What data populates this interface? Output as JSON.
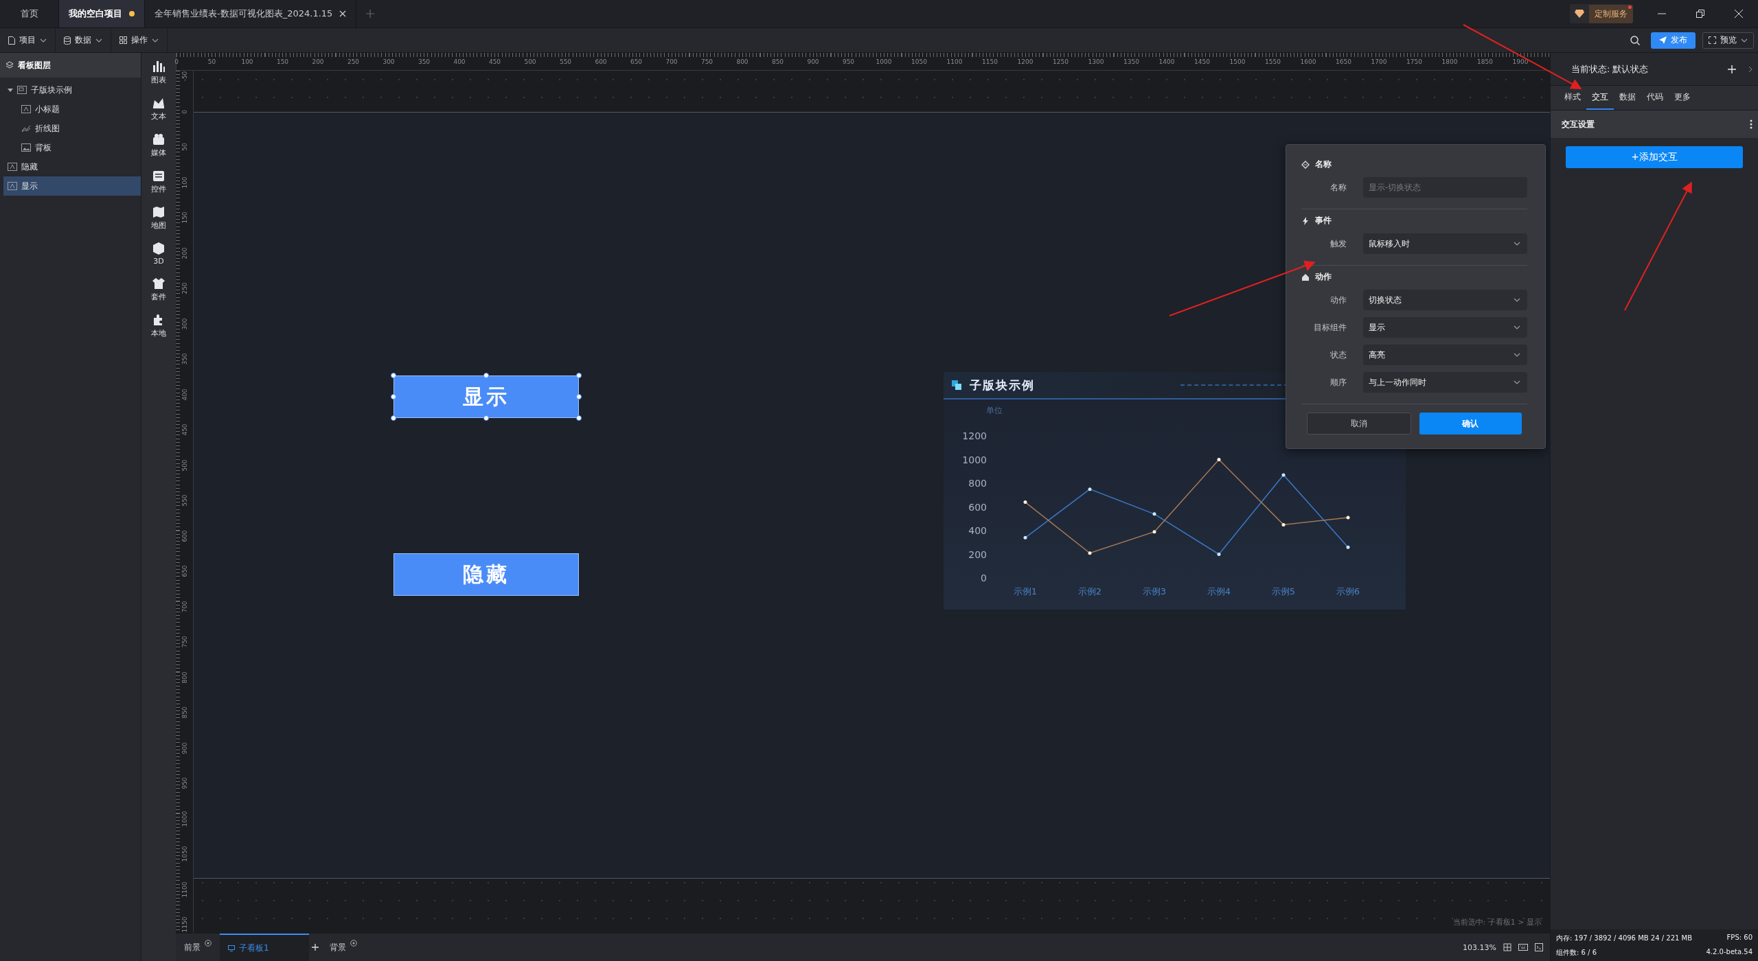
{
  "title_bar": {
    "tabs": [
      {
        "label": "首页",
        "selected": false,
        "modified": false,
        "closable": false
      },
      {
        "label": "我的空白项目",
        "selected": true,
        "modified": true,
        "closable": false
      },
      {
        "label": "全年销售业绩表-数据可视化图表_2024.1.15",
        "selected": false,
        "modified": false,
        "closable": true
      }
    ],
    "service_button": {
      "label": "定制服务",
      "badge": true
    }
  },
  "toolbar": {
    "menus": [
      "项目",
      "数据",
      "操作"
    ],
    "publish": "发布",
    "preview": "预览"
  },
  "layers": {
    "title": "看板图层",
    "items": [
      {
        "label": "子版块示例",
        "kind": "group",
        "expanded": true,
        "selected": false,
        "children": [
          {
            "label": "小标题",
            "kind": "text",
            "selected": false
          },
          {
            "label": "折线图",
            "kind": "chart",
            "selected": false
          },
          {
            "label": "背板",
            "kind": "image",
            "selected": false
          }
        ]
      },
      {
        "label": "隐藏",
        "kind": "text",
        "selected": false
      },
      {
        "label": "显示",
        "kind": "text",
        "selected": true
      }
    ]
  },
  "components": [
    "图表",
    "文本",
    "媒体",
    "控件",
    "地图",
    "3D",
    "套件",
    "本地"
  ],
  "ruler": {
    "x_ticks": [
      "0",
      "50",
      "100",
      "150",
      "200",
      "250",
      "300",
      "350",
      "400",
      "450",
      "500",
      "550",
      "600",
      "650",
      "700",
      "750",
      "800",
      "850",
      "900",
      "950",
      "1000",
      "1050",
      "1100",
      "1150",
      "1200",
      "1250",
      "1300",
      "1350",
      "1400",
      "1450",
      "1500",
      "1550",
      "1600",
      "1650",
      "1700",
      "1750",
      "1800",
      "1850",
      "1900"
    ],
    "y_ticks": [
      "-50",
      "0",
      "50",
      "100",
      "150",
      "200",
      "250",
      "300",
      "350",
      "400",
      "450",
      "500",
      "550",
      "600",
      "650",
      "700",
      "750",
      "800",
      "850",
      "900",
      "950",
      "1000",
      "1050",
      "1100",
      "1150"
    ]
  },
  "canvas": {
    "widgets": [
      {
        "kind": "button",
        "label": "显示",
        "selected": true
      },
      {
        "kind": "button",
        "label": "隐藏",
        "selected": false
      },
      {
        "kind": "chart_panel",
        "title": "子版块示例",
        "chart_data": {
          "type": "line",
          "ylabel": "单位",
          "categories": [
            "示例1",
            "示例2",
            "示例3",
            "示例4",
            "示例5",
            "示例6"
          ],
          "ylim": [
            0,
            1200
          ],
          "yticks": [
            0,
            200,
            400,
            600,
            800,
            1000,
            1200
          ],
          "series": [
            {
              "color": "#3a78c8",
              "values": [
                340,
                750,
                540,
                200,
                870,
                260
              ]
            },
            {
              "color": "#a97a55",
              "values": [
                640,
                210,
                390,
                1000,
                450,
                510
              ]
            }
          ]
        }
      }
    ],
    "selection_path": "当前选中:  子看板1 > 显示"
  },
  "popup": {
    "sections": [
      {
        "title": "名称",
        "kind": "name",
        "fields": [
          {
            "label": "名称",
            "kind": "input",
            "placeholder": "显示-切换状态"
          }
        ]
      },
      {
        "title": "事件",
        "kind": "event",
        "fields": [
          {
            "label": "触发",
            "kind": "select",
            "value": "鼠标移入时"
          }
        ]
      },
      {
        "title": "动作",
        "kind": "action",
        "fields": [
          {
            "label": "动作",
            "kind": "select",
            "value": "切换状态"
          },
          {
            "label": "目标组件",
            "kind": "select",
            "value": "显示"
          },
          {
            "label": "状态",
            "kind": "select",
            "value": "高亮"
          },
          {
            "label": "顺序",
            "kind": "select",
            "value": "与上一动作同时"
          }
        ]
      }
    ],
    "buttons": [
      {
        "label": "取消",
        "kind": "secondary"
      },
      {
        "label": "确认",
        "kind": "primary"
      }
    ]
  },
  "right_panel": {
    "state_label": "当前状态:",
    "state_value": "默认状态",
    "tabs": [
      {
        "label": "样式",
        "selected": false
      },
      {
        "label": "交互",
        "selected": true
      },
      {
        "label": "数据",
        "selected": false
      },
      {
        "label": "代码",
        "selected": false
      },
      {
        "label": "更多",
        "selected": false
      }
    ],
    "section_title": "交互设置",
    "add_button": "+添加交互"
  },
  "bottom_bar": {
    "tabs": [
      {
        "label": "前景",
        "kind": "layer",
        "selected": false
      },
      {
        "label": "子看板1",
        "kind": "board",
        "selected": true
      },
      {
        "label": "背景",
        "kind": "layer",
        "selected": false
      }
    ],
    "zoom": "103.13%"
  },
  "status": {
    "memory": "内存:  197 / 3892 / 4096 MB   24 / 221 MB",
    "fps": "FPS:  60",
    "components": "组件数:  6 / 6",
    "version": "4.2.0-beta.54"
  }
}
